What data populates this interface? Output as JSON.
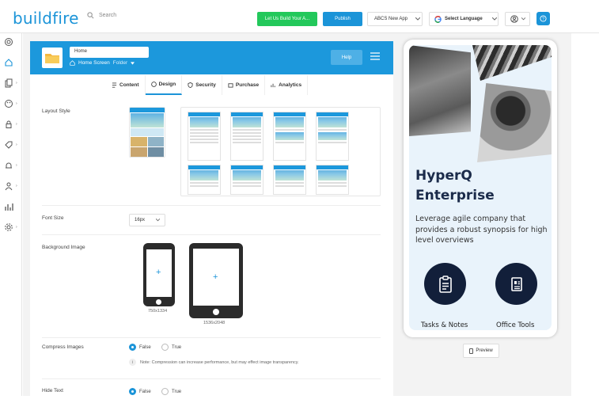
{
  "brand": {
    "logo": "buildfire"
  },
  "header": {
    "search_placeholder": "Search",
    "cta_label": "Let Us Build Your A...",
    "publish_label": "Publish",
    "app_name": "ABCS New App",
    "language_label": "Select Language"
  },
  "sidebar": {
    "items": [
      "dashboard",
      "home",
      "pages",
      "palette",
      "lock",
      "tag",
      "bell",
      "user",
      "analytics",
      "settings"
    ]
  },
  "panel": {
    "title_value": "Home",
    "screen_label": "Home Screen",
    "folder_label": "Folder",
    "help_label": "Help",
    "tabs": [
      {
        "label": "Content",
        "icon": "content-icon",
        "active": false
      },
      {
        "label": "Design",
        "icon": "design-icon",
        "active": true
      },
      {
        "label": "Security",
        "icon": "shield-icon",
        "active": false
      },
      {
        "label": "Purchase",
        "icon": "cart-icon",
        "active": false
      },
      {
        "label": "Analytics",
        "icon": "chart-icon",
        "active": false
      }
    ],
    "layout_style_label": "Layout Style",
    "font_size_label": "Font Size",
    "font_size_value": "16px",
    "background_image_label": "Background Image",
    "phone_size": "750x1334",
    "tablet_size": "1536x2048",
    "compress_label": "Compress Images",
    "compress_options": [
      "False",
      "True"
    ],
    "compress_selected": "False",
    "compress_note": "Note: Compression can increase performance, but may effect image transparency.",
    "hide_text_label": "Hide Text",
    "hide_text_options": [
      "False",
      "True"
    ],
    "hide_text_selected": "False"
  },
  "preview": {
    "title_line1": "HyperQ",
    "title_line2": "Enterprise",
    "description": "Leverage agile company that provides a robust synopsis for high level overviews",
    "feature1": "Tasks & Notes",
    "feature2": "Office Tools",
    "button_label": "Preview"
  },
  "colors": {
    "primary": "#1c98dc",
    "green": "#23c85b",
    "navy": "#121f3a"
  }
}
